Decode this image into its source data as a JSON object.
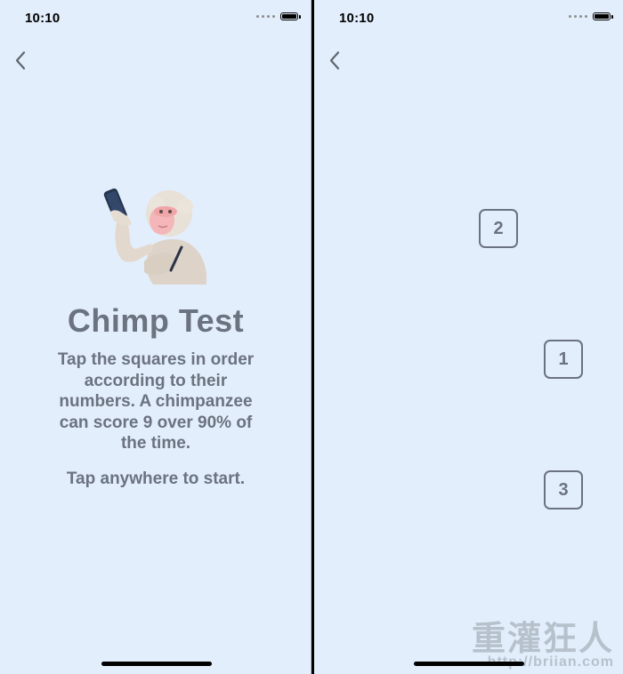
{
  "left_screen": {
    "status": {
      "time": "10:10"
    },
    "title": "Chimp Test",
    "description": "Tap the squares in order according to their numbers. A chimpanzee can score 9 over 90% of the time.",
    "cta": "Tap anywhere to start."
  },
  "right_screen": {
    "status": {
      "time": "10:10"
    },
    "squares": [
      {
        "label": "2"
      },
      {
        "label": "1"
      },
      {
        "label": "3"
      }
    ]
  },
  "watermark": {
    "text": "重灌狂人",
    "url": "http://briian.com"
  },
  "colors": {
    "background": "#e3eefc",
    "text": "#6b7280"
  }
}
